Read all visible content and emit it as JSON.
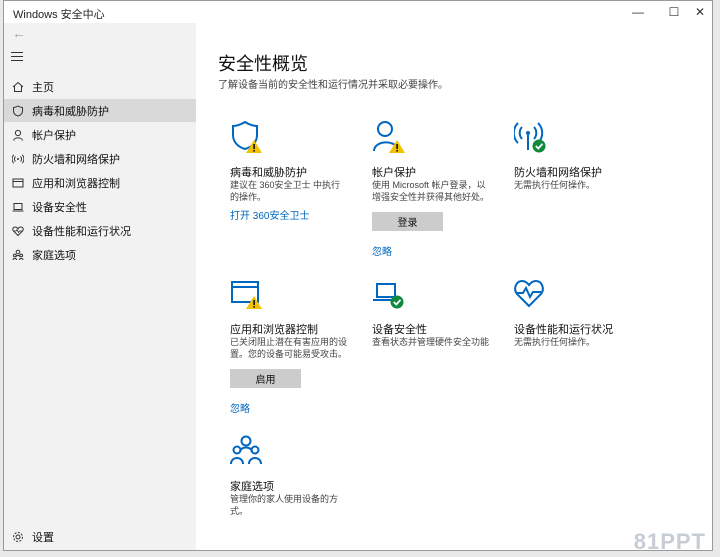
{
  "window": {
    "title": "Windows 安全中心",
    "minimize": "—",
    "maximize": "☐",
    "close": "✕"
  },
  "sidebar": {
    "items": [
      {
        "label": "主页"
      },
      {
        "label": "病毒和威胁防护"
      },
      {
        "label": "帐户保护"
      },
      {
        "label": "防火墙和网络保护"
      },
      {
        "label": "应用和浏览器控制"
      },
      {
        "label": "设备安全性"
      },
      {
        "label": "设备性能和运行状况"
      },
      {
        "label": "家庭选项"
      }
    ],
    "settings_label": "设置"
  },
  "main": {
    "title": "安全性概览",
    "subtitle": "了解设备当前的安全性和运行情况并采取必要操作。",
    "tiles": [
      {
        "name": "病毒和威胁防护",
        "desc": "建议在 360安全卫士 中执行的操作。",
        "link": "打开 360安全卫士"
      },
      {
        "name": "帐户保护",
        "desc": "使用 Microsoft 帐户登录，以增强安全性并获得其他好处。",
        "button": "登录",
        "link": "忽略"
      },
      {
        "name": "防火墙和网络保护",
        "desc": "无需执行任何操作。"
      },
      {
        "name": "应用和浏览器控制",
        "desc": "已关闭阻止潜在有害应用的设置。您的设备可能易受攻击。",
        "button": "启用",
        "link": "忽略"
      },
      {
        "name": "设备安全性",
        "desc": "查看状态并管理硬件安全功能"
      },
      {
        "name": "设备性能和运行状况",
        "desc": "无需执行任何操作。"
      },
      {
        "name": "家庭选项",
        "desc": "管理你的家人使用设备的方式。"
      }
    ]
  },
  "watermark": "81PPT",
  "colors": {
    "accent": "#0067c0",
    "warning": "#f2c200",
    "ok": "#10893e"
  }
}
